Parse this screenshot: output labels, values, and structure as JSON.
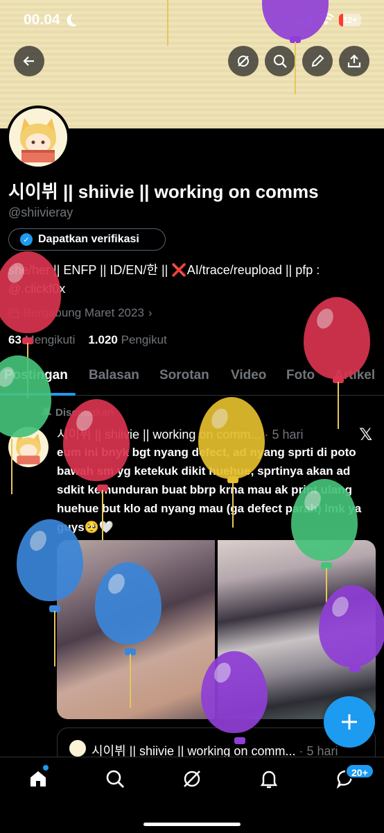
{
  "status_bar": {
    "time": "00.04",
    "battery": "12+"
  },
  "profile": {
    "display_name": "시이뷔 || shiivie || working on comms",
    "handle": "@shiivieray",
    "verify_label": "Dapatkan verifikasi",
    "bio_part1": "she/her || ENFP || ID/EN/한 || ",
    "bio_part2": "AI/trace/reupload || pfp : @.clickf0x",
    "joined": "Bergabung Maret 2023",
    "following_count": "63",
    "following_label": "Mengikuti",
    "followers_count": "1.020",
    "followers_label": "Pengikut"
  },
  "tabs": [
    {
      "label": "Postingan"
    },
    {
      "label": "Balasan"
    },
    {
      "label": "Sorotan"
    },
    {
      "label": "Video"
    },
    {
      "label": "Foto"
    },
    {
      "label": "Artikel"
    }
  ],
  "post": {
    "pinned_label": "Disematkan",
    "author": "시이뷔 || shiivie || working on comm...",
    "time_ago": "· 5 hari",
    "text": "eum ini bnyk bgt nyang defect, ad nyang sprti di poto bawah sm yg ketekuk dikit huehue, sprtinya akan ad sdkit kemunduran buat bbrp krna mau ak print ulang huehue but klo ad nyang mau  (ga defect parah) lmk ya guys🥺🤍"
  },
  "quote": {
    "author": "시이뷔 || shiivie || working on comm...",
    "time_ago": "· 5 hari"
  },
  "nav": {
    "messages_badge": "20+"
  },
  "colors": {
    "accent": "#1d9bf0",
    "background": "#000000",
    "muted": "#71767b"
  }
}
